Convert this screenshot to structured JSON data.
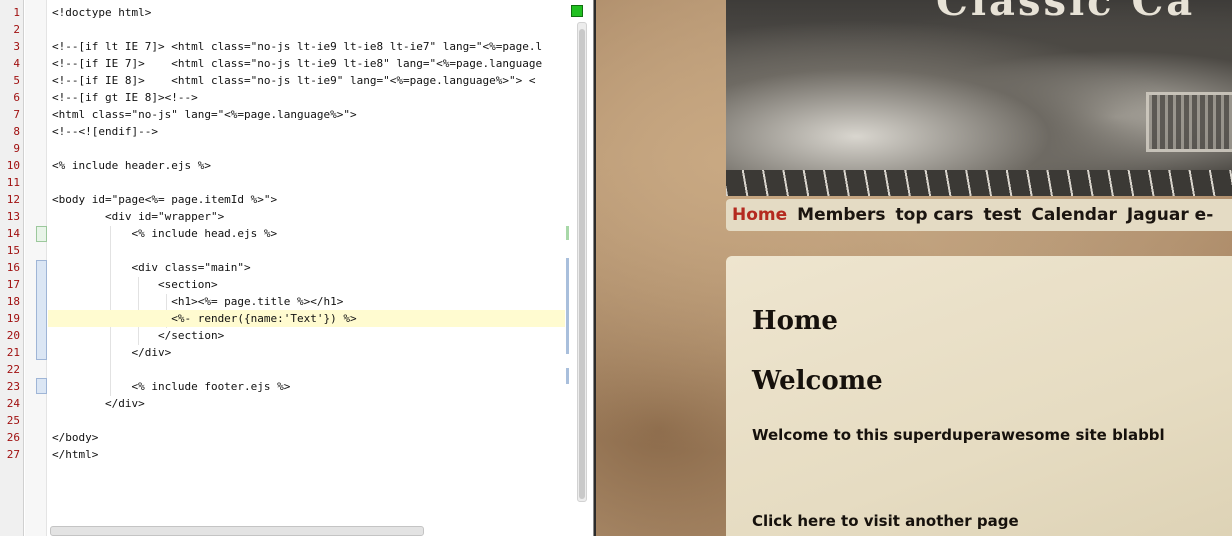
{
  "editor": {
    "line_numbers": [
      "1",
      "2",
      "3",
      "4",
      "5",
      "6",
      "7",
      "8",
      "9",
      "10",
      "11",
      "12",
      "13",
      "14",
      "15",
      "16",
      "17",
      "18",
      "19",
      "20",
      "21",
      "22",
      "23",
      "24",
      "25",
      "26",
      "27"
    ],
    "lines": [
      "<!doctype html>",
      "",
      "<!--[if lt IE 7]> <html class=\"no-js lt-ie9 lt-ie8 lt-ie7\" lang=\"<%=page.l",
      "<!--[if IE 7]>    <html class=\"no-js lt-ie9 lt-ie8\" lang=\"<%=page.language",
      "<!--[if IE 8]>    <html class=\"no-js lt-ie9\" lang=\"<%=page.language%>\"> <",
      "<!--[if gt IE 8]><!-->",
      "<html class=\"no-js\" lang=\"<%=page.language%>\">",
      "<!--<![endif]-->",
      "",
      "<% include header.ejs %>",
      "",
      "<body id=\"page<%= page.itemId %>\">",
      "        <div id=\"wrapper\">",
      "            <% include head.ejs %>",
      "",
      "            <div class=\"main\">",
      "                <section>",
      "                  <h1><%= page.title %></h1>",
      "                  <%- render({name:'Text'}) %>",
      "                </section>",
      "            </div>",
      "",
      "            <% include footer.ejs %>",
      "        </div>",
      "",
      "</body>",
      "</html>"
    ],
    "active_line": 19,
    "status_color": "#21c021"
  },
  "site": {
    "hero_title": "Classic Ca",
    "nav": [
      "Home",
      "Members",
      "top cars",
      "test",
      "Calendar",
      "Jaguar e-"
    ],
    "active_nav": "Home",
    "page_title": "Home",
    "welcome_heading": "Welcome",
    "welcome_text": "Welcome to this superduperawesome site blabbl",
    "link_text": "Click here to visit another page",
    "accent_color": "#b42a20"
  }
}
